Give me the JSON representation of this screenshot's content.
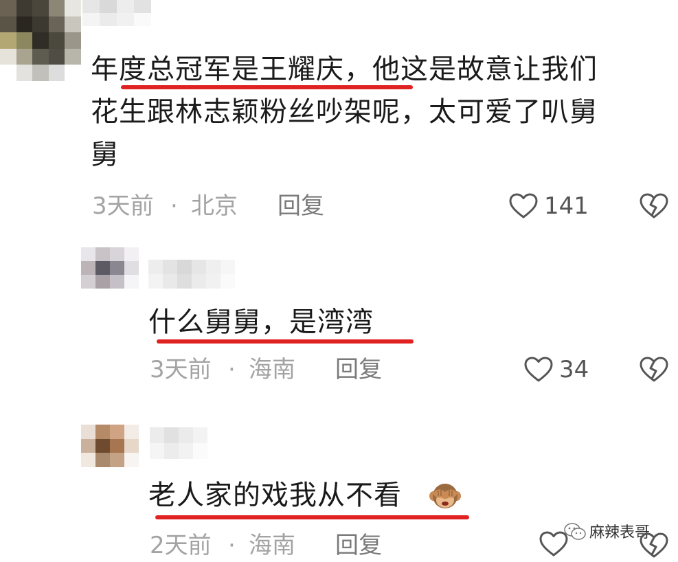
{
  "comments": [
    {
      "text_line1": "年度总冠军是王耀庆，他这是故意让我们",
      "text_line2": "花生跟林志颖粉丝吵架呢，太可爱了叭舅",
      "text_line3": "舅",
      "time": "3天前",
      "sep": "·",
      "location": "北京",
      "reply": "回复",
      "likes": "141",
      "like_icon": "heart-icon",
      "dislike_icon": "broken-heart-icon"
    },
    {
      "text": "什么舅舅，是湾湾",
      "time": "3天前",
      "sep": "·",
      "location": "海南",
      "reply": "回复",
      "likes": "34",
      "like_icon": "heart-icon",
      "dislike_icon": "broken-heart-icon"
    },
    {
      "text": "老人家的戏我从不看",
      "emoji": "see-no-evil-monkey",
      "time": "2天前",
      "sep": "·",
      "location": "海南",
      "reply": "回复",
      "likes": "",
      "like_icon": "heart-icon",
      "dislike_icon": "broken-heart-icon"
    }
  ],
  "watermark": {
    "text": "麻辣表哥",
    "icon": "wechat-icon"
  },
  "colors": {
    "underline": "#e02222",
    "meta_gray": "#a3a3a3",
    "text": "#1a1a1a"
  }
}
